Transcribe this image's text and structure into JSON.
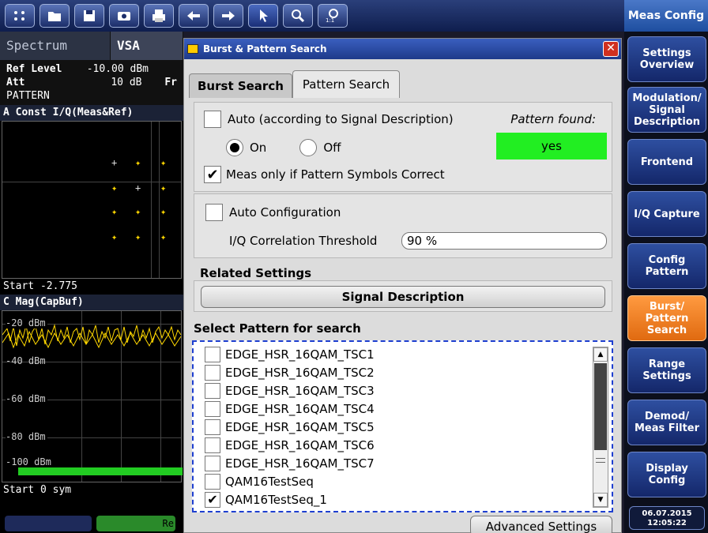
{
  "toolbar": {
    "icons": [
      "display-config-icon",
      "open-icon",
      "save-icon",
      "screenshot-icon",
      "print-icon",
      "undo-icon",
      "redo-icon",
      "pointer-icon",
      "zoom-icon",
      "zoom-reset-icon"
    ]
  },
  "left": {
    "tabs": [
      "Spectrum",
      "VSA"
    ],
    "info": {
      "ref_level_label": "Ref Level",
      "ref_level_value": "-10.00 dBm",
      "att_label": "Att",
      "att_value": "10 dB",
      "freq_trunc": "Fr",
      "mode": "PATTERN"
    },
    "const_title": "A Const I/Q(Meas&Ref)",
    "const_start": "Start -2.775",
    "mag_title": "C Mag(CapBuf)",
    "mag_levels": [
      "-20 dBm",
      "-40 dBm",
      "-60 dBm",
      "-80 dBm",
      "-100 dBm"
    ],
    "mag_start": "Start 0 sym",
    "bottom_trunc": "Re"
  },
  "dialog": {
    "title": "Burst & Pattern Search",
    "tabs": [
      "Burst Search",
      "Pattern Search"
    ],
    "auto_label": "Auto (according to Signal Description)",
    "on_label": "On",
    "off_label": "Off",
    "pattern_found_label": "Pattern found:",
    "pattern_found_value": "yes",
    "meas_only_label": "Meas only if Pattern Symbols Correct",
    "auto_config_label": "Auto Configuration",
    "threshold_label": "I/Q Correlation Threshold",
    "threshold_value": "90 %",
    "related_settings": "Related Settings",
    "signal_description_btn": "Signal Description",
    "select_pattern_label": "Select Pattern for search",
    "patterns": [
      {
        "name": "EDGE_HSR_16QAM_TSC1",
        "checked": false
      },
      {
        "name": "EDGE_HSR_16QAM_TSC2",
        "checked": false
      },
      {
        "name": "EDGE_HSR_16QAM_TSC3",
        "checked": false
      },
      {
        "name": "EDGE_HSR_16QAM_TSC4",
        "checked": false
      },
      {
        "name": "EDGE_HSR_16QAM_TSC5",
        "checked": false
      },
      {
        "name": "EDGE_HSR_16QAM_TSC6",
        "checked": false
      },
      {
        "name": "EDGE_HSR_16QAM_TSC7",
        "checked": false
      },
      {
        "name": "QAM16TestSeq",
        "checked": false
      },
      {
        "name": "QAM16TestSeq_1",
        "checked": true
      }
    ],
    "advanced_btn": "Advanced Settings"
  },
  "softkeys": {
    "header": "Meas Config",
    "items": [
      "Settings\nOverview",
      "Modulation/\nSignal\nDescription",
      "Frontend",
      "I/Q Capture",
      "Config\nPattern",
      "Burst/\nPattern\nSearch",
      "Range\nSettings",
      "Demod/\nMeas Filter",
      "Display\nConfig"
    ],
    "active": "Burst/\nPattern\nSearch",
    "date": "06.07.2015",
    "time": "12:05:22"
  },
  "colors": {
    "accent_active": "#f08020",
    "found_green": "#22ee22",
    "list_border": "#1e3fd0",
    "trace_yellow": "#ffd800"
  }
}
